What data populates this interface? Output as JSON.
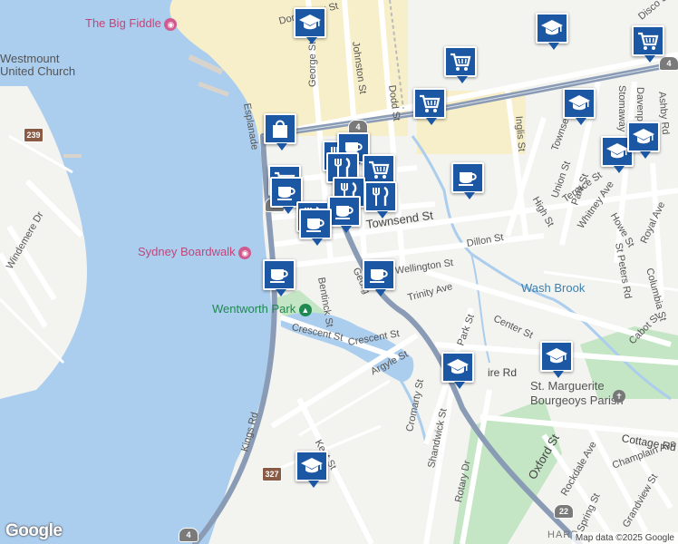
{
  "map": {
    "place_labels": [
      {
        "id": "big-fiddle",
        "text": "The Big Fiddle",
        "kind": "pink",
        "icon": "camera-icon"
      },
      {
        "id": "westmount",
        "text": "Westmount\nUnited Church",
        "kind": "dark",
        "icon": ""
      },
      {
        "id": "sydney-boardwalk",
        "text": "Sydney Boardwalk",
        "kind": "pink",
        "icon": "camera-icon"
      },
      {
        "id": "wentworth-park",
        "text": "Wentworth Park",
        "kind": "park",
        "icon": "tree-icon"
      },
      {
        "id": "wash-brook",
        "text": "Wash Brook",
        "kind": "water",
        "icon": ""
      },
      {
        "id": "st-marguerite",
        "text": "St. Marguerite\nBourgeoys Parish",
        "kind": "dark",
        "icon": "cross-icon"
      }
    ],
    "street_labels": [
      "Dorchester St",
      "George St",
      "Johnston St",
      "Dodd St",
      "Esplanade",
      "Townsend St",
      "Dillon St",
      "Bentinck St",
      "Georg",
      "Wellington St",
      "Trinity Ave",
      "Crescent St",
      "Crescent St",
      "Argyle St",
      "Kings Rd",
      "Kent St",
      "Inglis St",
      "Townsend St",
      "Terrace St",
      "Union St",
      "Park St",
      "High St",
      "Whitney Ave",
      "Howe St",
      "St Peters Rd",
      "Royal Ave",
      "Columbia St",
      "Stomaway",
      "Davenport",
      "Ashby Rd",
      "Disco St",
      "Center St",
      "Park St",
      "Cromarty St",
      "Shandwick St",
      "Rotary Dr",
      "Oxford St",
      "Rockdale Ave",
      "Grandview St",
      "Spring St",
      "Cottage Rd",
      "Champlain Ave",
      "Cabot St",
      "Windemere Dr",
      "ire Rd",
      "HARD"
    ],
    "shields": [
      "239",
      "4",
      "4",
      "4",
      "22",
      "22",
      "327",
      "4"
    ],
    "markers": [
      {
        "type": "school",
        "icon": "graduation-cap-icon"
      },
      {
        "type": "school",
        "icon": "graduation-cap-icon"
      },
      {
        "type": "shopping",
        "icon": "shopping-cart-icon"
      },
      {
        "type": "shopping",
        "icon": "shopping-cart-icon"
      },
      {
        "type": "shopping",
        "icon": "shopping-cart-icon"
      },
      {
        "type": "school",
        "icon": "graduation-cap-icon"
      },
      {
        "type": "school",
        "icon": "graduation-cap-icon"
      },
      {
        "type": "school",
        "icon": "graduation-cap-icon"
      },
      {
        "type": "cafe",
        "icon": "coffee-cup-icon"
      },
      {
        "type": "shopping",
        "icon": "shopping-bag-icon"
      },
      {
        "type": "restaurant",
        "icon": "fork-knife-icon"
      },
      {
        "type": "cafe",
        "icon": "coffee-cup-icon"
      },
      {
        "type": "shopping",
        "icon": "shopping-cart-icon"
      },
      {
        "type": "restaurant",
        "icon": "fork-knife-icon"
      },
      {
        "type": "shopping",
        "icon": "shopping-cart-icon"
      },
      {
        "type": "restaurant",
        "icon": "fork-knife-icon"
      },
      {
        "type": "restaurant",
        "icon": "fork-knife-icon"
      },
      {
        "type": "cafe",
        "icon": "coffee-cup-icon"
      },
      {
        "type": "restaurant",
        "icon": "fork-knife-icon"
      },
      {
        "type": "cafe",
        "icon": "coffee-cup-icon"
      },
      {
        "type": "cafe",
        "icon": "coffee-cup-icon"
      },
      {
        "type": "cafe",
        "icon": "coffee-cup-icon"
      },
      {
        "type": "cafe",
        "icon": "coffee-cup-icon"
      },
      {
        "type": "school",
        "icon": "graduation-cap-icon"
      },
      {
        "type": "school",
        "icon": "graduation-cap-icon"
      },
      {
        "type": "school",
        "icon": "graduation-cap-icon"
      }
    ],
    "logo": "Google",
    "attribution": "Map data ©2025 Google",
    "colors": {
      "water": "#abcdee",
      "land": "#f3f3f0",
      "road": "#ffffff",
      "highway": "#8a9bb5",
      "park": "#c4e6c5",
      "downtown": "#f7efc9",
      "marker": "#1c57a3"
    }
  }
}
